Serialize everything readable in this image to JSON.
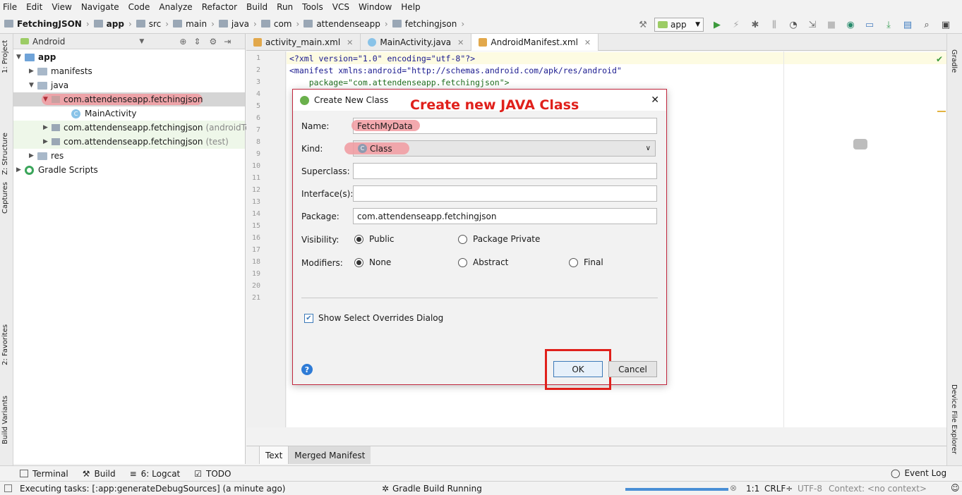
{
  "menu": [
    "File",
    "Edit",
    "View",
    "Navigate",
    "Code",
    "Analyze",
    "Refactor",
    "Build",
    "Run",
    "Tools",
    "VCS",
    "Window",
    "Help"
  ],
  "breadcrumb": [
    "FetchingJSON",
    "app",
    "src",
    "main",
    "java",
    "com",
    "attendenseapp",
    "fetchingjson"
  ],
  "run_config": "app",
  "left_strip": {
    "project": "1: Project",
    "structure": "Z: Structure",
    "captures": "Captures",
    "favorites": "2: Favorites",
    "build_variants": "Build Variants"
  },
  "right_strip": {
    "gradle": "Gradle",
    "device_explorer": "Device File Explorer"
  },
  "project_panel": {
    "view": "Android",
    "tree": [
      {
        "label": "app"
      },
      {
        "label": "manifests"
      },
      {
        "label": "java"
      },
      {
        "label": "com.attendenseapp.fetchingjson"
      },
      {
        "label": "MainActivity"
      },
      {
        "label": "com.attendenseapp.fetchingjson",
        "suffix": "(androidTest)"
      },
      {
        "label": "com.attendenseapp.fetchingjson",
        "suffix": "(test)"
      },
      {
        "label": "res"
      },
      {
        "label": "Gradle Scripts"
      }
    ]
  },
  "editor_tabs": [
    "activity_main.xml",
    "MainActivity.java",
    "AndroidManifest.xml"
  ],
  "line_numbers": [
    "1",
    "2",
    "3",
    "4",
    "5",
    "6",
    "7",
    "8",
    "9",
    "10",
    "11",
    "12",
    "13",
    "14",
    "15",
    "16",
    "17",
    "18",
    "19",
    "20",
    "21"
  ],
  "code": {
    "l1": "<?xml version=\"1.0\" encoding=\"utf-8\"?>",
    "l2": "<manifest xmlns:android=\"http://schemas.android.com/apk/res/android\"",
    "l3": "    package=\"com.attendenseapp.fetchingjson\">"
  },
  "editor_bottom_tabs": [
    "Text",
    "Merged Manifest"
  ],
  "dialog": {
    "title": "Create New Class",
    "annotation": "Create new JAVA Class",
    "name_label": "Name:",
    "name_value": "FetchMyData",
    "kind_label": "Kind:",
    "kind_value": "Class",
    "superclass_label": "Superclass:",
    "interfaces_label": "Interface(s):",
    "package_label": "Package:",
    "package_value": "com.attendenseapp.fetchingjson",
    "visibility_label": "Visibility:",
    "visibility_public": "Public",
    "visibility_package_private": "Package Private",
    "modifiers_label": "Modifiers:",
    "modifier_none": "None",
    "modifier_abstract": "Abstract",
    "modifier_final": "Final",
    "overrides_checkbox": "Show Select Overrides Dialog",
    "ok": "OK",
    "cancel": "Cancel"
  },
  "tool_windows": [
    "Terminal",
    "Build",
    "6: Logcat",
    "TODO"
  ],
  "event_log": "Event Log",
  "status": {
    "task": "Executing tasks: [:app:generateDebugSources] (a minute ago)",
    "gradle": "Gradle Build Running",
    "position": "1:1",
    "line_sep": "CRLF÷",
    "encoding": "UTF-8",
    "context": "Context: <no context>"
  },
  "colors": {
    "annotation_red": "#e0201b",
    "highlight": "#f19aa0",
    "ok_border": "#e0201b"
  }
}
